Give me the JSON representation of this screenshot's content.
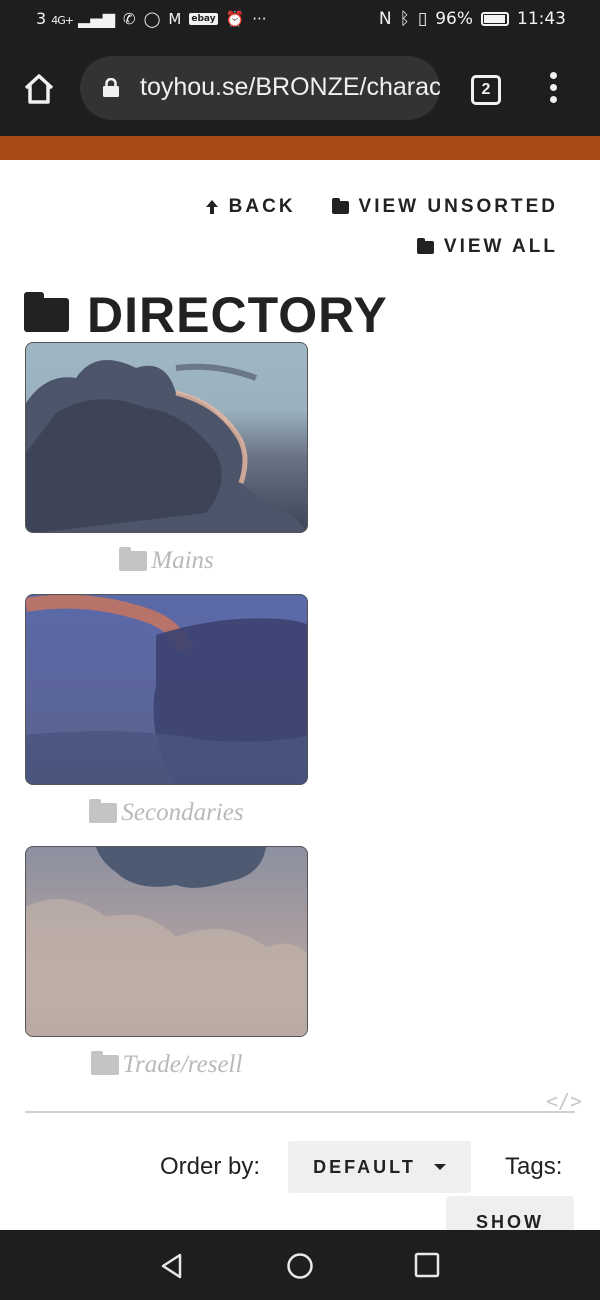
{
  "status_bar": {
    "network": "3",
    "signal_label": "4G+",
    "battery_percent": "96%",
    "time": "11:43",
    "notification_icons": [
      "missed-call-icon",
      "whatsapp-icon",
      "gmail-icon",
      "ebay-icon",
      "alarm-icon",
      "more-icon"
    ],
    "ebay_text": "ebay",
    "more_text": "···"
  },
  "browser": {
    "url": "toyhou.se/BRONZE/characters/folder",
    "tab_count": "2"
  },
  "colors": {
    "accent_bar": "#a84a14"
  },
  "nav_links": {
    "back": "BACK",
    "view_unsorted": "VIEW UNSORTED",
    "view_all": "VIEW ALL"
  },
  "directory": {
    "title": "DIRECTORY",
    "folders": [
      {
        "name": "Mains"
      },
      {
        "name": "Secondaries"
      },
      {
        "name": "Trade/resell"
      }
    ]
  },
  "embed_code_icon": "</>",
  "sort": {
    "order_by_label": "Order by:",
    "order_by_value": "DEFAULT",
    "tags_label": "Tags:",
    "show_button": "SHOW"
  }
}
